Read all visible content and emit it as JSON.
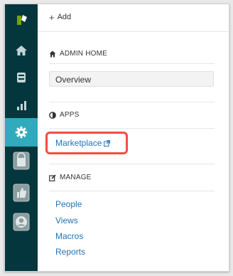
{
  "toolbar": {
    "add_label": "Add"
  },
  "sections": {
    "admin_home": {
      "heading": "ADMIN HOME",
      "overview": "Overview"
    },
    "apps": {
      "heading": "APPS",
      "marketplace": "Marketplace"
    },
    "manage": {
      "heading": "MANAGE",
      "links": [
        "People",
        "Views",
        "Macros",
        "Reports"
      ]
    }
  },
  "nav_rail": {
    "icons": [
      "zendesk-logo",
      "home-icon",
      "views-icon",
      "reporting-icon",
      "admin-gear-icon",
      "app-bag-icon",
      "thumbs-up-icon",
      "user-icon"
    ],
    "active": "admin-gear-icon"
  },
  "colors": {
    "rail_bg": "#03363d",
    "active_bg": "#30aabc",
    "link": "#1f73b7",
    "highlight": "#f14e45"
  }
}
